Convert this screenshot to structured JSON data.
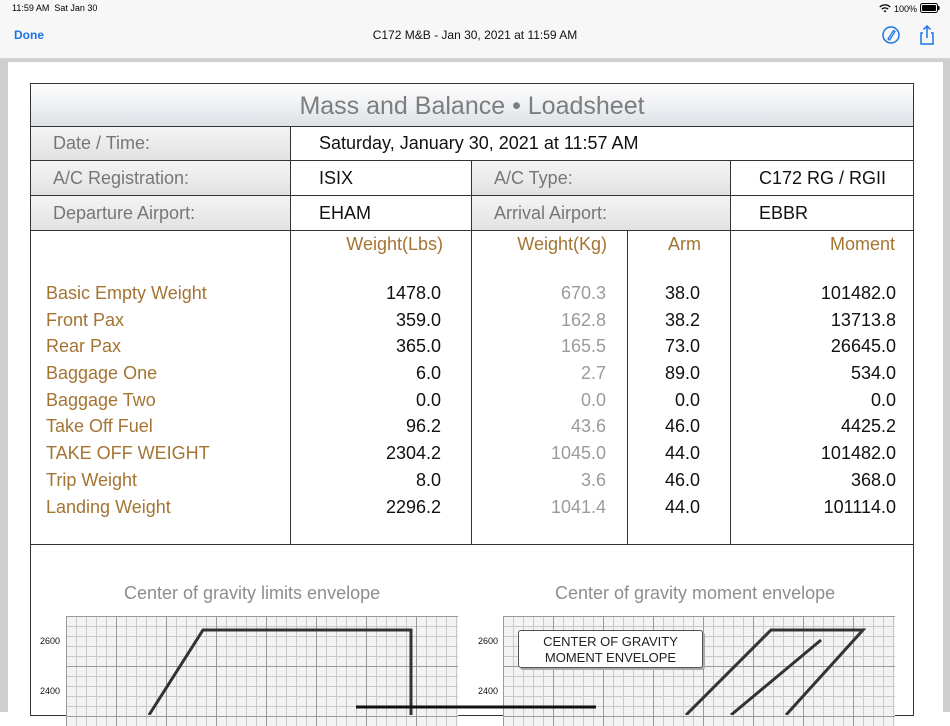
{
  "status": {
    "time": "11:59 AM",
    "date": "Sat Jan 30",
    "battery": "100%"
  },
  "nav": {
    "done_label": "Done",
    "title": "C172 M&B - Jan 30, 2021 at 11:59 AM"
  },
  "sheet": {
    "title": "Mass and Balance • Loadsheet",
    "date_label": "Date / Time:",
    "date_value": "Saturday, January 30, 2021 at 11:57 AM",
    "reg_label": "A/C Registration:",
    "reg_value": "ISIX",
    "type_label": "A/C Type:",
    "type_value": "C172 RG / RGII",
    "dep_label": "Departure Airport:",
    "dep_value": "EHAM",
    "arr_label": "Arrival Airport:",
    "arr_value": "EBBR"
  },
  "columns": {
    "lbs": "Weight(Lbs)",
    "kg": "Weight(Kg)",
    "arm": "Arm",
    "moment": "Moment"
  },
  "rows": [
    {
      "label": "Basic Empty Weight",
      "lbs": "1478.0",
      "kg": "670.3",
      "arm": "38.0",
      "moment": "101482.0"
    },
    {
      "label": "Front Pax",
      "lbs": "359.0",
      "kg": "162.8",
      "arm": "38.2",
      "moment": "13713.8"
    },
    {
      "label": "Rear Pax",
      "lbs": "365.0",
      "kg": "165.5",
      "arm": "73.0",
      "moment": "26645.0"
    },
    {
      "label": "Baggage One",
      "lbs": "6.0",
      "kg": "2.7",
      "arm": "89.0",
      "moment": "534.0"
    },
    {
      "label": "Baggage Two",
      "lbs": "0.0",
      "kg": "0.0",
      "arm": "0.0",
      "moment": "0.0"
    },
    {
      "label": "Take Off Fuel",
      "lbs": "96.2",
      "kg": "43.6",
      "arm": "46.0",
      "moment": "4425.2"
    },
    {
      "label": "TAKE OFF WEIGHT",
      "lbs": "2304.2",
      "kg": "1045.0",
      "arm": "44.0",
      "moment": "101482.0"
    },
    {
      "label": "Trip Weight",
      "lbs": "8.0",
      "kg": "3.6",
      "arm": "46.0",
      "moment": "368.0"
    },
    {
      "label": "Landing Weight",
      "lbs": "2296.2",
      "kg": "1041.4",
      "arm": "44.0",
      "moment": "101114.0"
    }
  ],
  "graphs": {
    "left_title": "Center of gravity limits envelope",
    "right_title": "Center of gravity moment envelope",
    "right_inset_line1": "CENTER OF GRAVITY",
    "right_inset_line2": "MOMENT ENVELOPE",
    "y_tick_top": "2600",
    "y_tick_bottom": "2400"
  },
  "colors": {
    "accent": "#1a73e8",
    "label_brown": "#a47432",
    "muted_gray": "#9b9b9b"
  }
}
